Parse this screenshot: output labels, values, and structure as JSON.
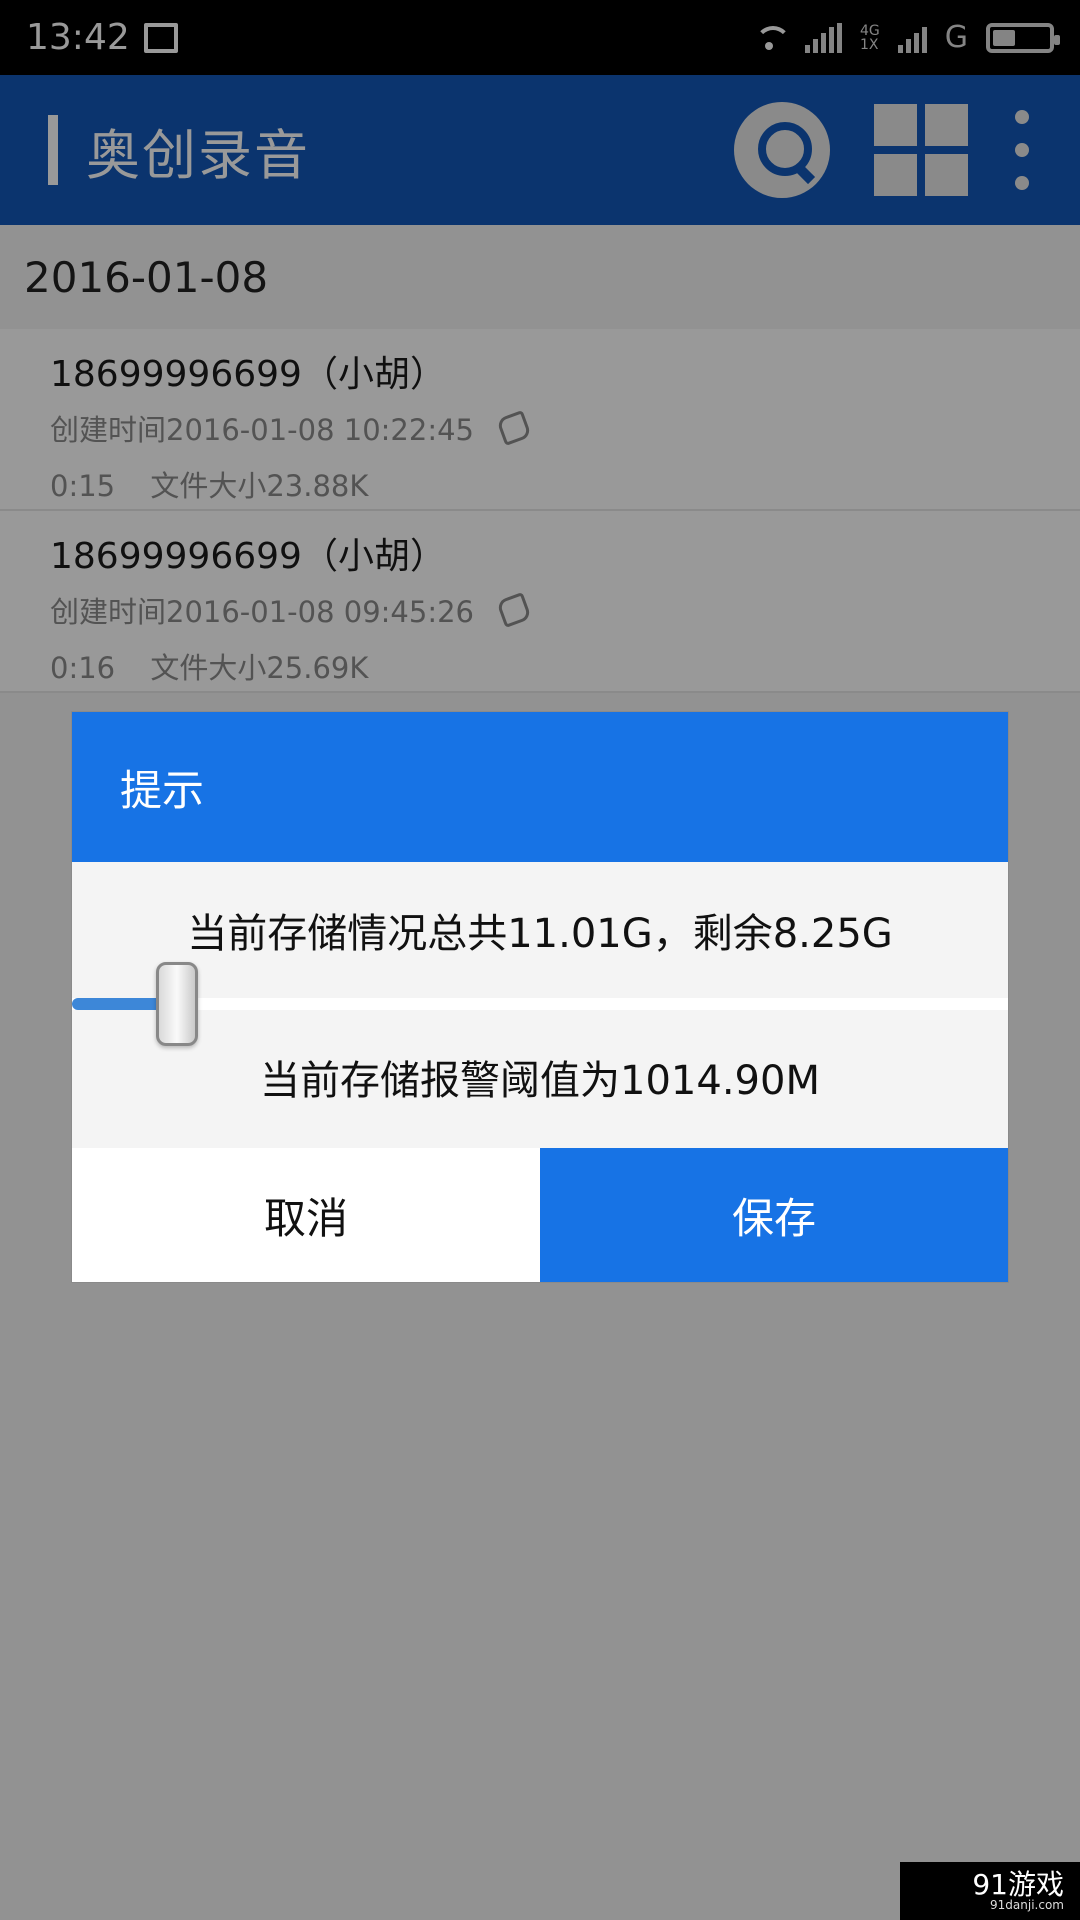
{
  "status_bar": {
    "time": "13:42",
    "network_4g": "4G",
    "network_1x": "1X",
    "network_g": "G",
    "icons": [
      "screenshot-icon",
      "wifi-icon",
      "signal-icon",
      "battery-icon"
    ]
  },
  "app_bar": {
    "title": "奥创录音",
    "icons": [
      "search-icon",
      "grid-icon",
      "more-icon"
    ],
    "color": "#1358b7"
  },
  "date_header": "2016-01-08",
  "records": [
    {
      "title": "18699996699（小胡）",
      "created": "创建时间2016-01-08 10:22:45",
      "duration": "0:15",
      "file_size": "文件大小23.88K"
    },
    {
      "title": "18699996699（小胡）",
      "created": "创建时间2016-01-08 09:45:26",
      "duration": "0:16",
      "file_size": "文件大小25.69K"
    }
  ],
  "dialog": {
    "title": "提示",
    "storage_text": "当前存储情况总共11.01G，剩余8.25G",
    "threshold_text": "当前存储报警阈值为1014.90M",
    "cancel_label": "取消",
    "save_label": "保存",
    "accent_color": "#1773e5"
  },
  "watermark": {
    "text": "91游戏",
    "url": "91danji.com"
  }
}
